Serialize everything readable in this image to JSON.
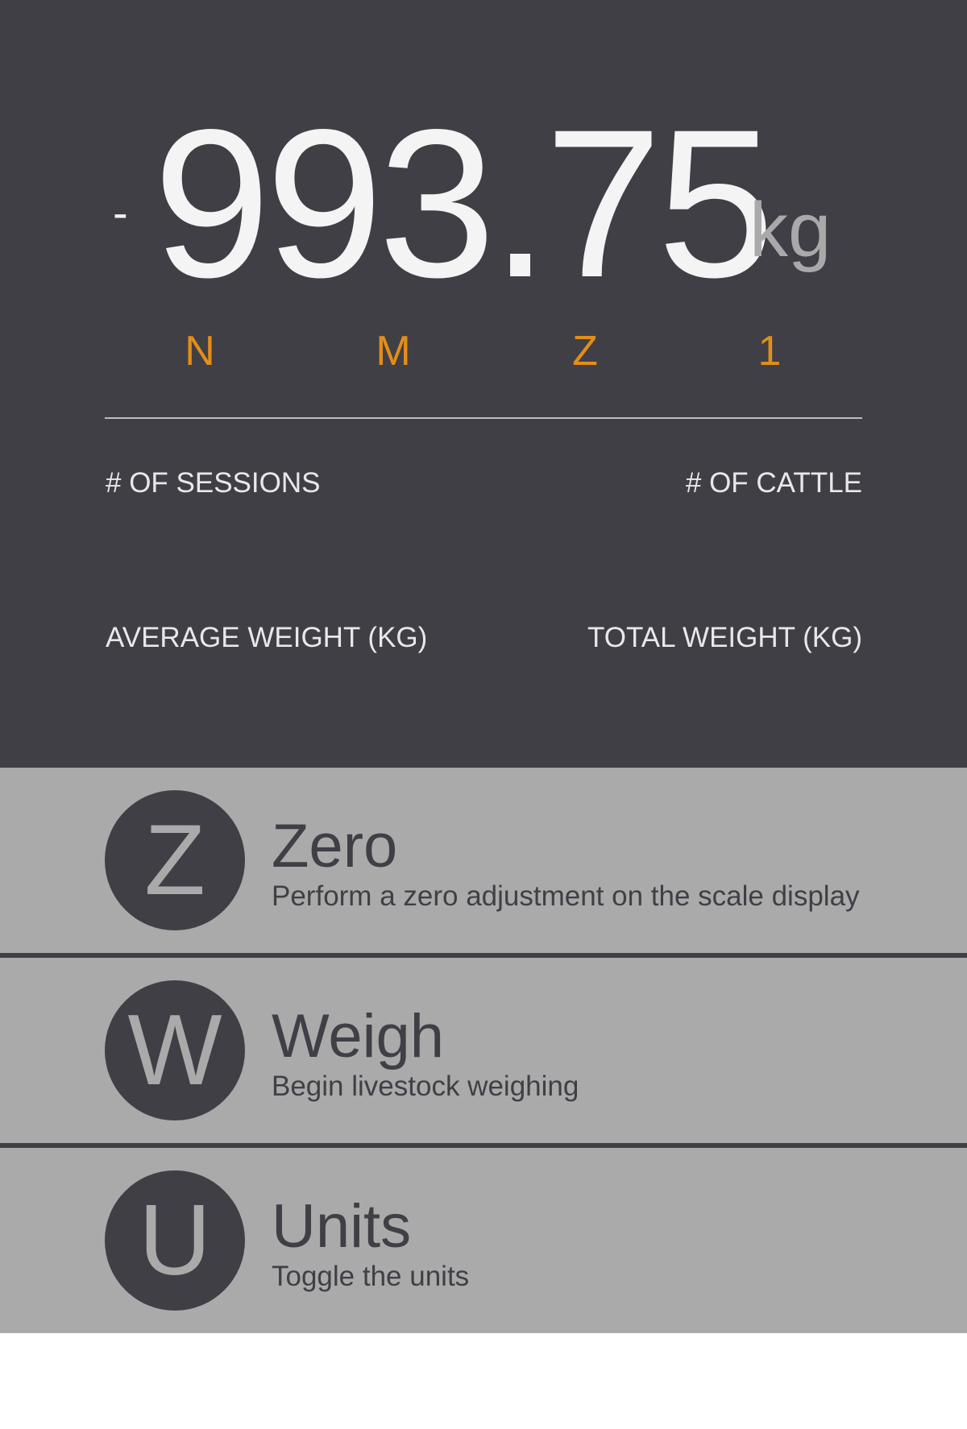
{
  "display": {
    "sign": "-",
    "weight": "993.75",
    "unit": "kg",
    "indicators": [
      "N",
      "M",
      "Z",
      "1"
    ],
    "indicator_color": "#e38e18"
  },
  "stats": {
    "sessions_label": "# OF SESSIONS",
    "cattle_label": "# OF CATTLE",
    "average_label": "AVERAGE WEIGHT (KG)",
    "total_label": "TOTAL WEIGHT (KG)"
  },
  "actions": [
    {
      "letter": "Z",
      "title": "Zero",
      "description": "Perform a zero adjustment on the scale display",
      "icon": "zero-letter-icon"
    },
    {
      "letter": "W",
      "title": "Weigh",
      "description": "Begin livestock weighing",
      "icon": "weigh-letter-icon"
    },
    {
      "letter": "U",
      "title": "Units",
      "description": "Toggle the units",
      "icon": "units-letter-icon"
    }
  ],
  "colors": {
    "panel_dark": "#403f46",
    "panel_gray": "#aaaaaa",
    "accent": "#e38e18"
  }
}
